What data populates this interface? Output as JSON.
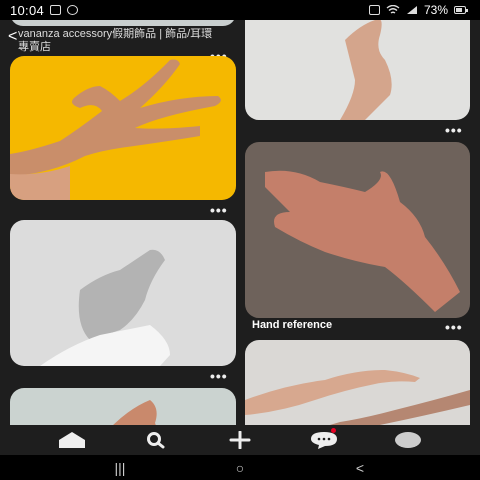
{
  "status": {
    "time": "10:04",
    "battery": "73%",
    "battery_level": 0.73
  },
  "feed": {
    "top_title": "vananza accessory假期飾品 | 飾品/耳環專賣店",
    "pins": [
      {
        "id": "pin-yellow-hand",
        "caption": ""
      },
      {
        "id": "pin-gray-hand-top",
        "caption": ""
      },
      {
        "id": "pin-brown-hand",
        "caption": "Hand reference"
      },
      {
        "id": "pin-bw-hand",
        "caption": ""
      },
      {
        "id": "pin-two-hands",
        "caption": ""
      },
      {
        "id": "pin-partial-hand",
        "caption": ""
      }
    ],
    "more_label": "•••"
  },
  "nav": {
    "items": [
      {
        "name": "home",
        "icon": "home-icon"
      },
      {
        "name": "search",
        "icon": "search-icon"
      },
      {
        "name": "create",
        "icon": "plus-icon"
      },
      {
        "name": "messages",
        "icon": "chat-icon"
      },
      {
        "name": "profile",
        "icon": "avatar-icon"
      }
    ]
  },
  "system_nav": {
    "recents": "|||",
    "home": "○",
    "back": "<"
  },
  "colors": {
    "background": "#1e1e1e",
    "yellow_card": "#f5b800",
    "notification": "#e60023"
  }
}
